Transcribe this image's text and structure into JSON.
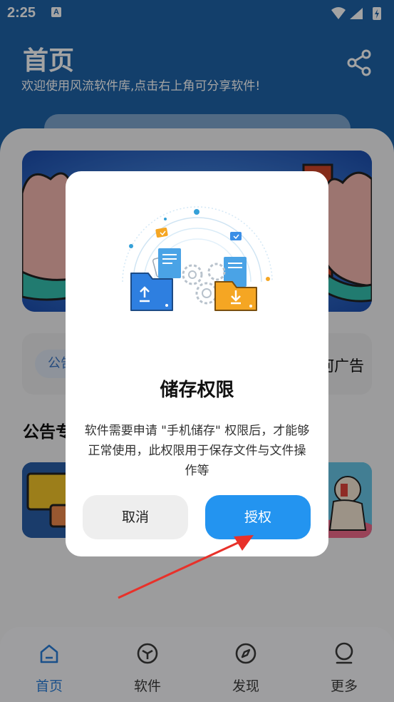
{
  "status_bar": {
    "time": "2:25",
    "notification_icon": "A"
  },
  "header": {
    "title": "首页",
    "subtitle": "欢迎使用风流软件库,点击右上角可分享软件!",
    "share_icon": "share-icon"
  },
  "notice": {
    "tag": "公告",
    "text_fragment": "何广告"
  },
  "section": {
    "title": "公告专"
  },
  "dialog": {
    "title": "储存权限",
    "message": "软件需要申请 \"手机储存\" 权限后，才能够正常使用，此权限用于保存文件与文件操作等",
    "cancel_label": "取消",
    "grant_label": "授权"
  },
  "bottom_nav": {
    "items": [
      {
        "label": "首页",
        "icon": "home-icon",
        "active": true
      },
      {
        "label": "软件",
        "icon": "cube-icon",
        "active": false
      },
      {
        "label": "发现",
        "icon": "compass-icon",
        "active": false
      },
      {
        "label": "更多",
        "icon": "user-icon",
        "active": false
      }
    ]
  },
  "colors": {
    "primary": "#2394f0",
    "header_bg": "#1f63a8",
    "active_nav": "#2a7ed8",
    "arrow": "#e8312a"
  }
}
